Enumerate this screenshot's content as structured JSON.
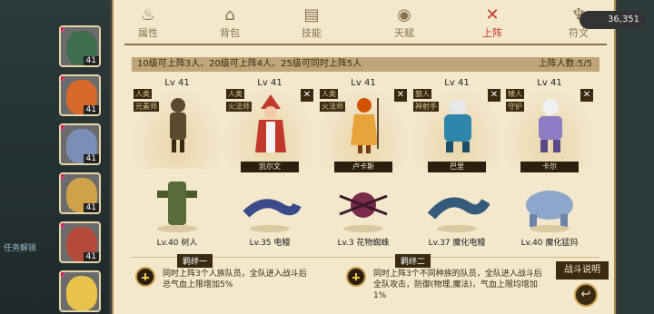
{
  "tabs": [
    {
      "label": "属性",
      "icon": "flame-icon"
    },
    {
      "label": "背包",
      "icon": "backpack-icon"
    },
    {
      "label": "技能",
      "icon": "book-icon"
    },
    {
      "label": "天赋",
      "icon": "eye-icon"
    },
    {
      "label": "上阵",
      "icon": "crossed-swords-icon",
      "active": true
    },
    {
      "label": "符文",
      "icon": "rune-icon"
    }
  ],
  "coins": "36,351",
  "info": {
    "rule_text": "10级可上阵3人、20级可上阵4人、25级可同时上阵5人",
    "count_text": "上阵人数:5/5"
  },
  "left_portraits": [
    {
      "level": "41",
      "color": "#3e6e4e"
    },
    {
      "level": "41",
      "color": "#d9682b"
    },
    {
      "level": "41",
      "color": "#7b8fb6"
    },
    {
      "level": "41",
      "color": "#cfa24a"
    },
    {
      "level": "41",
      "color": "#b44a3a"
    },
    {
      "level": "",
      "color": "#e8c24a"
    }
  ],
  "left_side_label": "任务解锁",
  "heroes": [
    {
      "level": "Lv 41",
      "tags": [
        "人类",
        "元素师"
      ],
      "name": "",
      "removable": false,
      "color": "#5b4a2e"
    },
    {
      "level": "Lv 41",
      "tags": [
        "人类",
        "火法师"
      ],
      "name": "凯尔文",
      "removable": true,
      "color": "#c0392b"
    },
    {
      "level": "Lv 41",
      "tags": [
        "人类",
        "火法师"
      ],
      "name": "卢卡斯",
      "removable": true,
      "color": "#d35400"
    },
    {
      "level": "Lv 41",
      "tags": [
        "狼人",
        "神射手"
      ],
      "name": "巴里",
      "removable": true,
      "color": "#2e86ab"
    },
    {
      "level": "Lv 41",
      "tags": [
        "矮人",
        "守护"
      ],
      "name": "卡尔",
      "removable": true,
      "color": "#8e7cc3"
    }
  ],
  "pets": [
    {
      "name": "Lv.40 树人",
      "color": "#5a6b3a"
    },
    {
      "name": "Lv.35 电鳗",
      "color": "#3b4a8a"
    },
    {
      "name": "Lv.3  花物蜘蛛",
      "color": "#7a2a4a"
    },
    {
      "name": "Lv.37 魔化电鳗",
      "color": "#355a7a"
    },
    {
      "name": "Lv.40 魔化猛犸",
      "color": "#8ea6c9"
    }
  ],
  "bonds": [
    {
      "title": "羁绊一",
      "text": "同时上阵3个人族队员，全队进入战斗后总气血上限增加5%"
    },
    {
      "title": "羁绊二",
      "text": "同时上阵3个不同种族的队员，全队进入战斗后全队攻击，防御(物理,魔法)，气血上限均增加1%"
    }
  ],
  "battle_button": "战斗说明",
  "back_button_icon": "back-arrow-icon"
}
